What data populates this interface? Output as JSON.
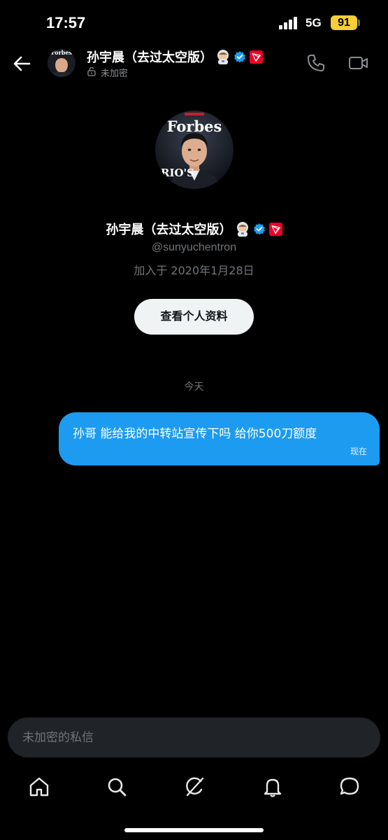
{
  "status_bar": {
    "time": "17:57",
    "network": "5G",
    "battery": "91",
    "battery_color": "#f5cf35"
  },
  "header": {
    "name": "孙宇晨（去过太空版）",
    "subtitle": "未加密",
    "icons": [
      "back-arrow-icon",
      "lock-open-icon",
      "astronaut-emoji",
      "verified-badge-icon",
      "tron-logo-icon",
      "phone-icon",
      "video-icon"
    ]
  },
  "profile": {
    "avatar_magazine_text": "Forbes",
    "name": "孙宇晨（去过太空版）",
    "handle": "@sunyuchentron",
    "joined": "加入于 2020年1月28日",
    "view_profile_label": "查看个人资料"
  },
  "conversation": {
    "date_divider": "今天",
    "messages": [
      {
        "text": "孙哥 能给我的中转站宣传下吗 给你500刀额度",
        "time": "现在",
        "from": "me"
      }
    ]
  },
  "composer": {
    "placeholder": "未加密的私信"
  },
  "bottom_nav": {
    "items": [
      "home-icon",
      "search-icon",
      "grok-icon",
      "notifications-icon",
      "messages-icon"
    ]
  },
  "colors": {
    "background": "#000000",
    "accent": "#1d9bf0",
    "verified": "#1d9bf0",
    "tron": "#eb0029",
    "muted_text": "#71767b"
  }
}
